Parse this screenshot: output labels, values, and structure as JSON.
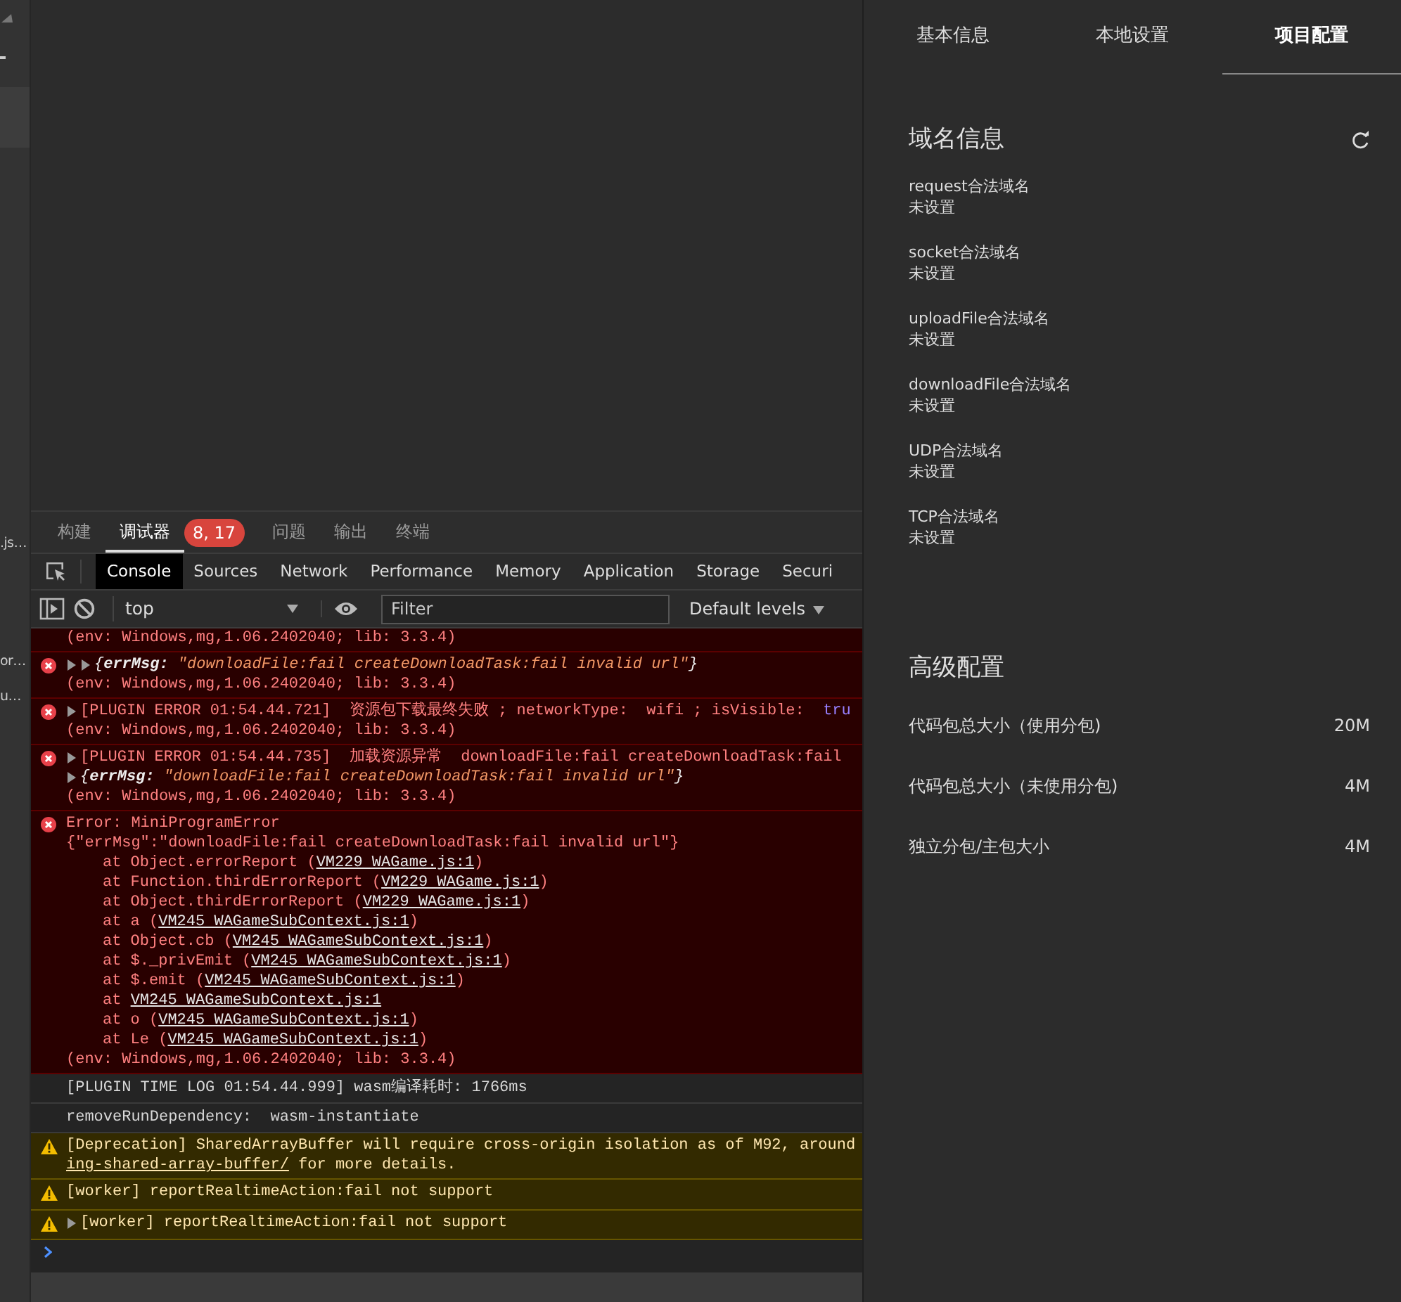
{
  "sidebar": {
    "items": [
      {
        "label": ".js…"
      },
      {
        "label": "or…"
      },
      {
        "label": "u…"
      }
    ]
  },
  "drawer_tabs": [
    {
      "label": "构建",
      "selected": false
    },
    {
      "label": "调试器",
      "selected": true,
      "badge": "8, 17"
    },
    {
      "label": "问题",
      "selected": false
    },
    {
      "label": "输出",
      "selected": false
    },
    {
      "label": "终端",
      "selected": false
    }
  ],
  "devtools_tabs": [
    {
      "label": "Console",
      "selected": true
    },
    {
      "label": "Sources",
      "selected": false
    },
    {
      "label": "Network",
      "selected": false
    },
    {
      "label": "Performance",
      "selected": false
    },
    {
      "label": "Memory",
      "selected": false
    },
    {
      "label": "Application",
      "selected": false
    },
    {
      "label": "Storage",
      "selected": false
    },
    {
      "label": "Securi",
      "selected": false
    }
  ],
  "console_toolbar": {
    "context": "top",
    "filter": {
      "placeholder": "Filter"
    },
    "levels": "Default levels"
  },
  "console": {
    "entries": [
      {
        "kind": "error",
        "cut_top": true,
        "lines": [
          {
            "indent": false,
            "parts": [
              {
                "kind": "text",
                "text": "(env: Windows,mg,1.06.2402040; lib: 3.3.4)"
              }
            ]
          }
        ]
      },
      {
        "kind": "error",
        "cut_top": false,
        "lines": [
          {
            "expanders": [
              {
                "expanded": false
              },
              {
                "expanded": false
              }
            ],
            "indent": false,
            "parts": [
              {
                "kind": "punct",
                "text": "{"
              },
              {
                "kind": "key",
                "text": "errMsg:"
              },
              {
                "kind": "str",
                "text": " \"downloadFile:fail createDownloadTask:fail invalid url\""
              },
              {
                "kind": "punct",
                "text": "}"
              }
            ]
          },
          {
            "indent": false,
            "parts": [
              {
                "kind": "text",
                "text": "(env: Windows,mg,1.06.2402040; lib: 3.3.4)"
              }
            ]
          }
        ]
      },
      {
        "kind": "error",
        "cut_top": false,
        "lines": [
          {
            "expanders": [
              {
                "expanded": false
              }
            ],
            "indent": false,
            "parts": [
              {
                "kind": "text",
                "text": "[PLUGIN ERROR 01:54.44.721]  资源包下载最终失败 ; networkType:  wifi ; isVisible:  "
              },
              {
                "kind": "bool",
                "text": "tru"
              }
            ]
          },
          {
            "indent": false,
            "parts": [
              {
                "kind": "text",
                "text": "(env: Windows,mg,1.06.2402040; lib: 3.3.4)"
              }
            ]
          }
        ]
      },
      {
        "kind": "error",
        "cut_top": false,
        "lines": [
          {
            "expanders": [
              {
                "expanded": false
              }
            ],
            "indent": false,
            "parts": [
              {
                "kind": "text",
                "text": "[PLUGIN ERROR 01:54.44.735]  加载资源异常  downloadFile:fail createDownloadTask:fail"
              }
            ]
          },
          {
            "expanders": [
              {
                "expanded": false
              }
            ],
            "indent": false,
            "parts": [
              {
                "kind": "punct",
                "text": "{"
              },
              {
                "kind": "key",
                "text": "errMsg:"
              },
              {
                "kind": "str",
                "text": " \"downloadFile:fail createDownloadTask:fail invalid url\""
              },
              {
                "kind": "punct",
                "text": "}"
              }
            ]
          },
          {
            "indent": false,
            "parts": [
              {
                "kind": "text",
                "text": "(env: Windows,mg,1.06.2402040; lib: 3.3.4)"
              }
            ]
          }
        ]
      },
      {
        "kind": "error",
        "cut_top": false,
        "lines": [
          {
            "indent": false,
            "parts": [
              {
                "kind": "text",
                "text": "Error: MiniProgramError"
              }
            ]
          },
          {
            "indent": false,
            "parts": [
              {
                "kind": "text",
                "text": "{\"errMsg\":\"downloadFile:fail createDownloadTask:fail invalid url\"}"
              }
            ]
          },
          {
            "indent": true,
            "parts": [
              {
                "kind": "text",
                "text": "at Object.errorReport ("
              },
              {
                "kind": "link",
                "text": "VM229 WAGame.js:1"
              },
              {
                "kind": "text",
                "text": ")"
              }
            ]
          },
          {
            "indent": true,
            "parts": [
              {
                "kind": "text",
                "text": "at Function.thirdErrorReport ("
              },
              {
                "kind": "link",
                "text": "VM229 WAGame.js:1"
              },
              {
                "kind": "text",
                "text": ")"
              }
            ]
          },
          {
            "indent": true,
            "parts": [
              {
                "kind": "text",
                "text": "at Object.thirdErrorReport ("
              },
              {
                "kind": "link",
                "text": "VM229 WAGame.js:1"
              },
              {
                "kind": "text",
                "text": ")"
              }
            ]
          },
          {
            "indent": true,
            "parts": [
              {
                "kind": "text",
                "text": "at a ("
              },
              {
                "kind": "link",
                "text": "VM245 WAGameSubContext.js:1"
              },
              {
                "kind": "text",
                "text": ")"
              }
            ]
          },
          {
            "indent": true,
            "parts": [
              {
                "kind": "text",
                "text": "at Object.cb ("
              },
              {
                "kind": "link",
                "text": "VM245 WAGameSubContext.js:1"
              },
              {
                "kind": "text",
                "text": ")"
              }
            ]
          },
          {
            "indent": true,
            "parts": [
              {
                "kind": "text",
                "text": "at $._privEmit ("
              },
              {
                "kind": "link",
                "text": "VM245 WAGameSubContext.js:1"
              },
              {
                "kind": "text",
                "text": ")"
              }
            ]
          },
          {
            "indent": true,
            "parts": [
              {
                "kind": "text",
                "text": "at $.emit ("
              },
              {
                "kind": "link",
                "text": "VM245 WAGameSubContext.js:1"
              },
              {
                "kind": "text",
                "text": ")"
              }
            ]
          },
          {
            "indent": true,
            "parts": [
              {
                "kind": "text",
                "text": "at "
              },
              {
                "kind": "link",
                "text": "VM245 WAGameSubContext.js:1"
              }
            ]
          },
          {
            "indent": true,
            "parts": [
              {
                "kind": "text",
                "text": "at o ("
              },
              {
                "kind": "link",
                "text": "VM245 WAGameSubContext.js:1"
              },
              {
                "kind": "text",
                "text": ")"
              }
            ]
          },
          {
            "indent": true,
            "parts": [
              {
                "kind": "text",
                "text": "at Le ("
              },
              {
                "kind": "link",
                "text": "VM245 WAGameSubContext.js:1"
              },
              {
                "kind": "text",
                "text": ")"
              }
            ]
          },
          {
            "indent": false,
            "parts": [
              {
                "kind": "text",
                "text": "(env: Windows,mg,1.06.2402040; lib: 3.3.4)"
              }
            ]
          }
        ]
      },
      {
        "kind": "info",
        "cut_top": false,
        "lines": [
          {
            "indent": false,
            "parts": [
              {
                "kind": "text",
                "text": "[PLUGIN TIME LOG 01:54.44.999] wasm编译耗时: 1766ms"
              }
            ]
          }
        ]
      },
      {
        "kind": "info",
        "cut_top": false,
        "lines": [
          {
            "indent": false,
            "parts": [
              {
                "kind": "text",
                "text": "removeRunDependency:  wasm-instantiate"
              }
            ]
          }
        ]
      },
      {
        "kind": "warning",
        "cut_top": false,
        "lines": [
          {
            "indent": false,
            "parts": [
              {
                "kind": "text",
                "text": "[Deprecation] SharedArrayBuffer will require cross-origin isolation as of M92, around"
              }
            ]
          },
          {
            "indent": false,
            "parts": [
              {
                "kind": "link",
                "text": "ing-shared-array-buffer/"
              },
              {
                "kind": "text",
                "text": " for more details."
              }
            ]
          }
        ]
      },
      {
        "kind": "warning",
        "cut_top": false,
        "lines": [
          {
            "indent": false,
            "parts": [
              {
                "kind": "text",
                "text": "[worker] reportRealtimeAction:fail not support"
              }
            ]
          }
        ]
      },
      {
        "kind": "warning",
        "cut_top": false,
        "lines": [
          {
            "expanders": [
              {
                "expanded": false
              }
            ],
            "indent": false,
            "parts": [
              {
                "kind": "text",
                "text": "[worker] reportRealtimeAction:fail not support"
              }
            ]
          }
        ]
      }
    ]
  },
  "settings_tabs": [
    {
      "label": "基本信息",
      "selected": false
    },
    {
      "label": "本地设置",
      "selected": false
    },
    {
      "label": "项目配置",
      "selected": true
    }
  ],
  "domain_section": {
    "title": "域名信息",
    "items": [
      {
        "label": "request合法域名",
        "value": "未设置"
      },
      {
        "label": "socket合法域名",
        "value": "未设置"
      },
      {
        "label": "uploadFile合法域名",
        "value": "未设置"
      },
      {
        "label": "downloadFile合法域名",
        "value": "未设置"
      },
      {
        "label": "UDP合法域名",
        "value": "未设置"
      },
      {
        "label": "TCP合法域名",
        "value": "未设置"
      }
    ]
  },
  "advanced_section": {
    "title": "高级配置",
    "rows": [
      {
        "label": "代码包总大小（使用分包)",
        "value": "20M"
      },
      {
        "label": "代码包总大小（未使用分包)",
        "value": "4M"
      },
      {
        "label": "独立分包/主包大小",
        "value": "4M"
      }
    ]
  }
}
